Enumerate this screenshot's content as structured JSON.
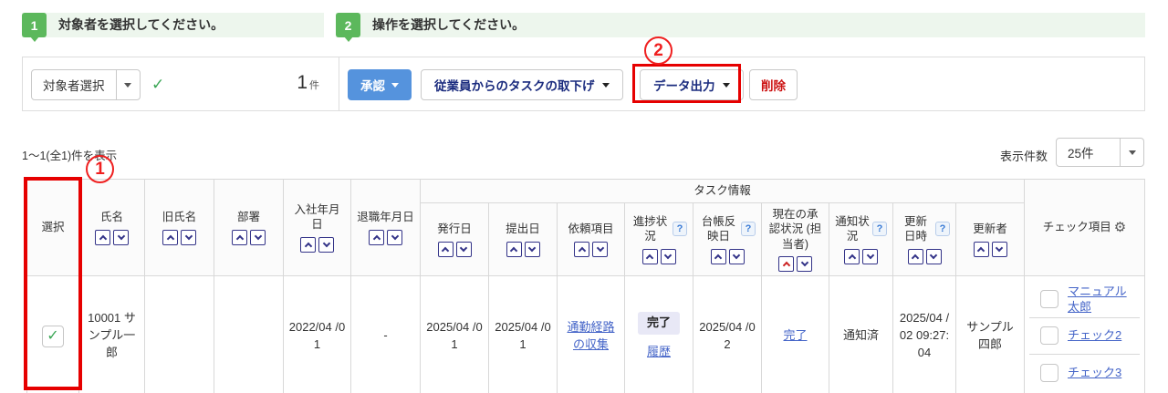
{
  "steps": [
    {
      "number": "1",
      "label": "対象者を選択してください。"
    },
    {
      "number": "2",
      "label": "操作を選択してください。"
    }
  ],
  "toolbar": {
    "target_select": "対象者選択",
    "selected_count": "1",
    "count_unit": "件",
    "approve": "承認",
    "withdraw": "従業員からのタスクの取下げ",
    "export": "データ出力",
    "delete": "削除"
  },
  "list_controls": {
    "range_text": "1〜1(全1)件を表示",
    "per_page_label": "表示件数",
    "per_page_value": "25件"
  },
  "annotations": {
    "circle1": "1",
    "circle2": "2"
  },
  "icons": {
    "check": "✓",
    "gear": "⚙",
    "help": "?"
  },
  "colors": {
    "step_green": "#5cb85c",
    "approve_blue": "#5593dd",
    "annotation_red": "#e60000",
    "link_blue": "#4565c8",
    "navy_text": "#1a2b7e"
  },
  "table": {
    "group_header": "タスク情報",
    "headers": {
      "select": "選択",
      "name": "氏名",
      "former_name": "旧氏名",
      "department": "部署",
      "hire_date": "入社年月日",
      "retire_date": "退職年月日",
      "issue_date": "発行日",
      "submit_date": "提出日",
      "request_item": "依頼項目",
      "progress": "進捗状況",
      "ledger_date": "台帳反映日",
      "approval": "現在の承認状況 (担当者)",
      "notify": "通知状況",
      "updated_at": "更新日時",
      "updater": "更新者",
      "check_items": "チェック項目"
    },
    "row": {
      "name": "10001 サンプル一郎",
      "former_name": "",
      "department": "",
      "hire_date": "2022/04 /01",
      "retire_date": "-",
      "issue_date": "2025/04 /01",
      "submit_date": "2025/04 /01",
      "request_item": "通勤経路の収集",
      "progress_status": "完了",
      "progress_history": "履歴",
      "ledger_date": "2025/04 /02",
      "approval_status": "完了",
      "notify_status": "通知済",
      "updated_at": "2025/04 /02 09:27:04",
      "updater": "サンプル四郎",
      "check_items": [
        {
          "label": "マニュアル太郎"
        },
        {
          "label": "チェック2"
        },
        {
          "label": "チェック3"
        }
      ]
    }
  }
}
